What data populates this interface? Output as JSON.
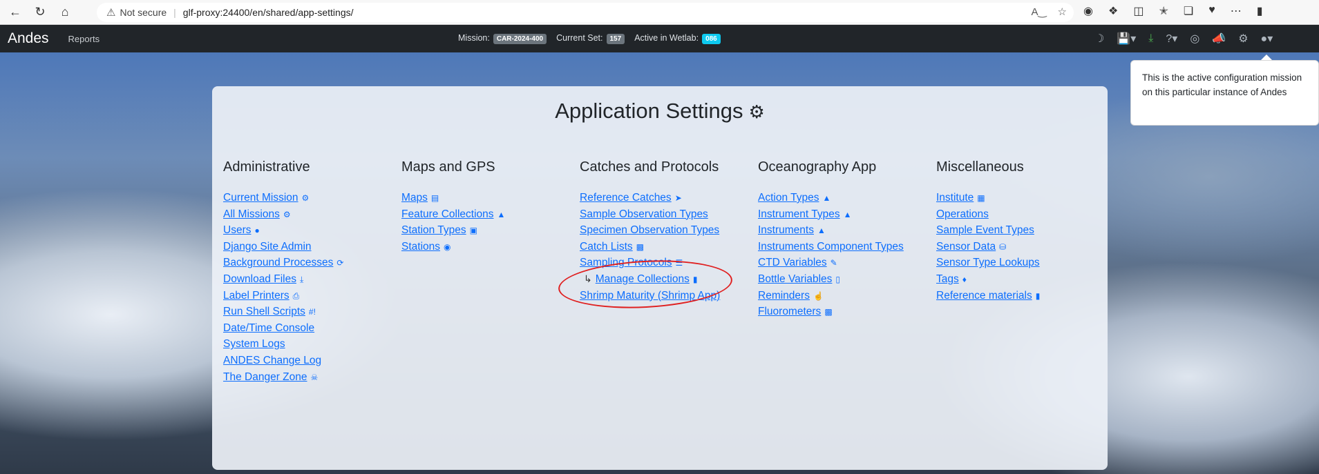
{
  "browser": {
    "not_secure": "Not secure",
    "url": "glf-proxy:24400/en/shared/app-settings/"
  },
  "navbar": {
    "brand": "Andes",
    "reports": "Reports",
    "mission_label": "Mission:",
    "mission_value": "CAR-2024-400",
    "current_set_label": "Current Set:",
    "current_set_value": "157",
    "wetlab_label": "Active in Wetlab:",
    "wetlab_value": "086"
  },
  "tooltip": {
    "text": "This is the active configuration mission on this particular instance of Andes"
  },
  "page": {
    "title": "Application Settings"
  },
  "columns": [
    {
      "heading": "Administrative",
      "links": [
        {
          "label": "Current Mission",
          "icon": "gear-icon"
        },
        {
          "label": "All Missions",
          "icon": "gears-icon"
        },
        {
          "label": "Users",
          "icon": "user-icon"
        },
        {
          "label": "Django Site Admin",
          "icon": ""
        },
        {
          "label": "Background Processes",
          "icon": "sync-icon"
        },
        {
          "label": "Download Files",
          "icon": "download-icon"
        },
        {
          "label": "Label Printers",
          "icon": "printer-icon"
        },
        {
          "label": "Run Shell Scripts",
          "icon": "terminal-icon"
        },
        {
          "label": "Date/Time Console",
          "icon": ""
        },
        {
          "label": "System Logs",
          "icon": ""
        },
        {
          "label": "ANDES Change Log",
          "icon": ""
        },
        {
          "label": "The Danger Zone",
          "icon": "skull-icon"
        }
      ]
    },
    {
      "heading": "Maps and GPS",
      "links": [
        {
          "label": "Maps",
          "icon": "map-icon"
        },
        {
          "label": "Feature Collections",
          "icon": "shapes-icon"
        },
        {
          "label": "Station Types",
          "icon": "vector-icon"
        },
        {
          "label": "Stations",
          "icon": "pin-icon"
        }
      ]
    },
    {
      "heading": "Catches and Protocols",
      "links": [
        {
          "label": "Reference Catches",
          "icon": "fish-icon"
        },
        {
          "label": "Sample Observation Types",
          "icon": ""
        },
        {
          "label": "Specimen Observation Types",
          "icon": ""
        },
        {
          "label": "Catch Lists",
          "icon": "clipboard-icon"
        },
        {
          "label": "Sampling Protocols",
          "icon": "list-check-icon"
        },
        {
          "label": "Manage Collections",
          "icon": "collection-icon"
        },
        {
          "label": "Shrimp Maturity (Shrimp App)",
          "icon": ""
        }
      ]
    },
    {
      "heading": "Oceanography App",
      "links": [
        {
          "label": "Action Types",
          "icon": "rocket-icon"
        },
        {
          "label": "Instrument Types",
          "icon": "rocket-icon"
        },
        {
          "label": "Instruments",
          "icon": "rocket-icon"
        },
        {
          "label": "Instruments Component Types",
          "icon": ""
        },
        {
          "label": "CTD Variables",
          "icon": "pencil-icon"
        },
        {
          "label": "Bottle Variables",
          "icon": "bottle-icon"
        },
        {
          "label": "Reminders",
          "icon": "hand-icon"
        },
        {
          "label": "Fluorometers",
          "icon": "device-icon"
        }
      ]
    },
    {
      "heading": "Miscellaneous",
      "links": [
        {
          "label": "Institute",
          "icon": "building-icon"
        },
        {
          "label": "Operations",
          "icon": ""
        },
        {
          "label": "Sample Event Types",
          "icon": ""
        },
        {
          "label": "Sensor Data",
          "icon": "database-icon"
        },
        {
          "label": "Sensor Type Lookups",
          "icon": ""
        },
        {
          "label": "Tags",
          "icon": "tag-icon"
        },
        {
          "label": "Reference materials",
          "icon": "book-icon"
        }
      ]
    }
  ]
}
